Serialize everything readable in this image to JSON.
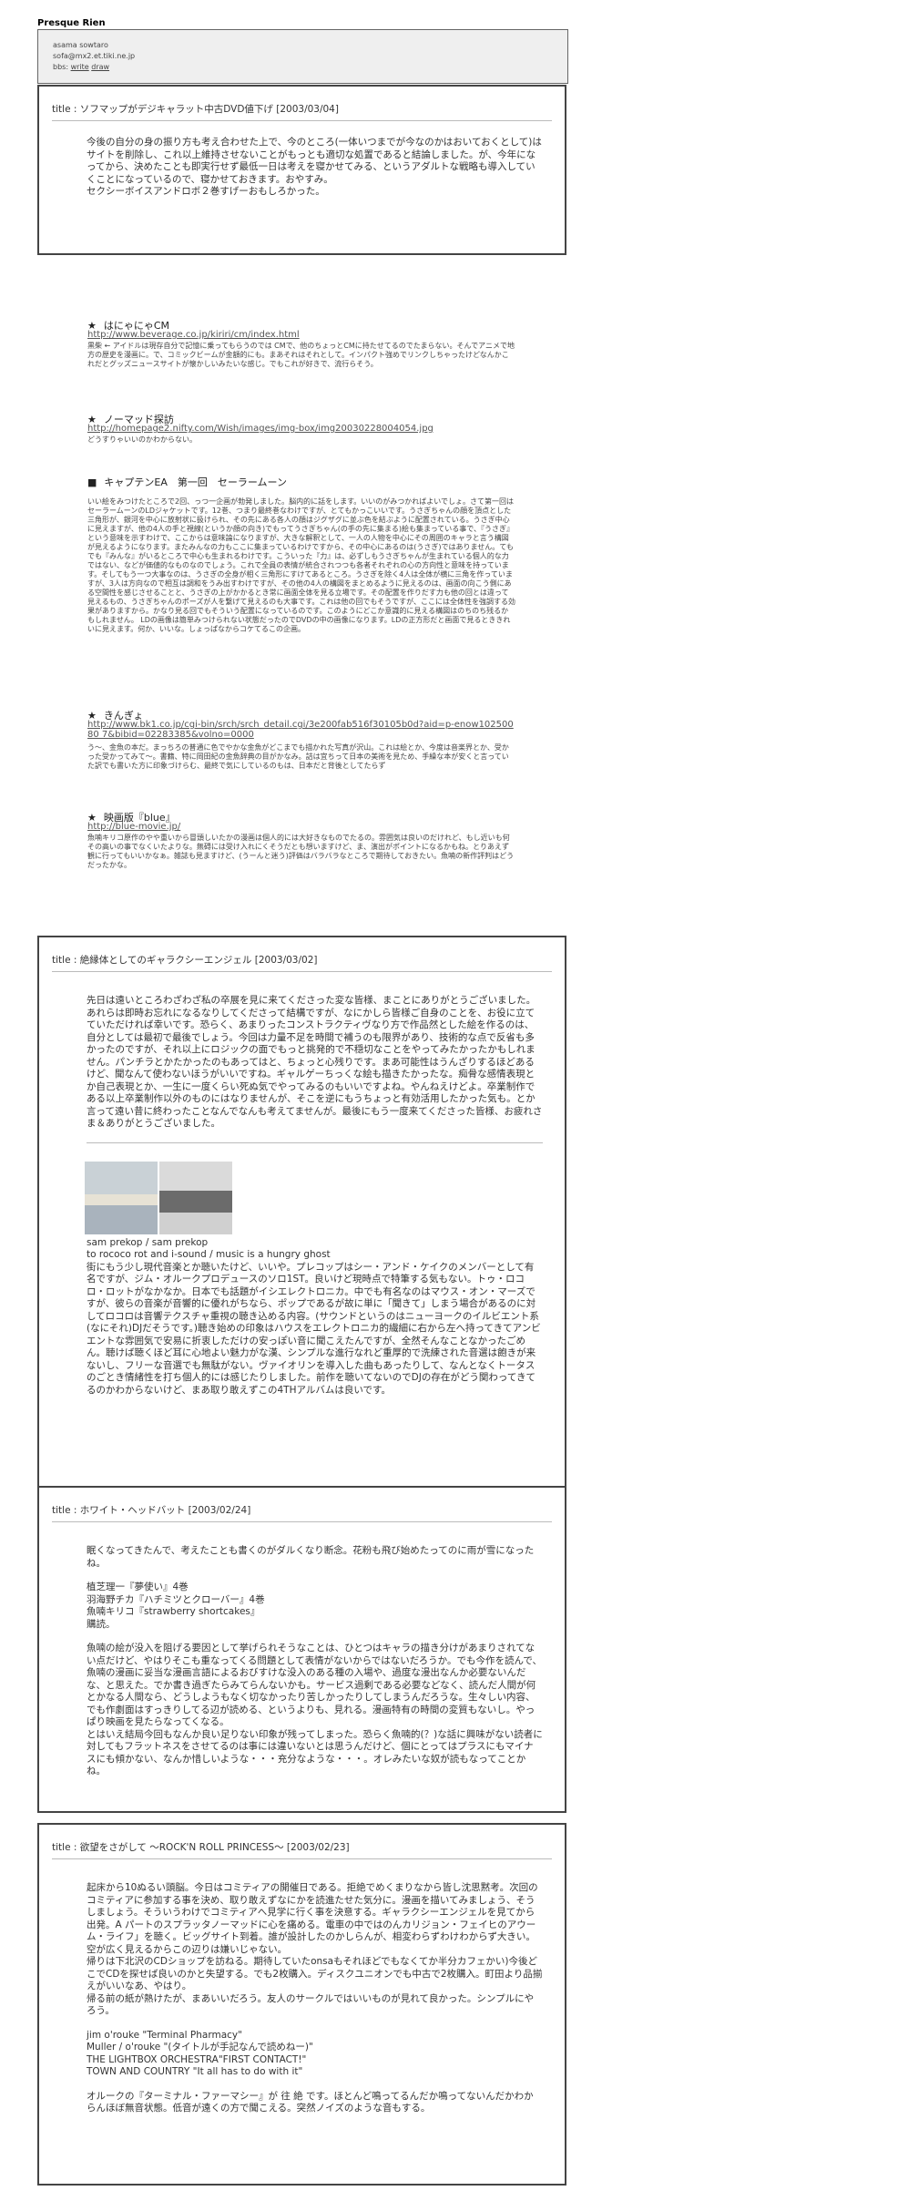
{
  "site": {
    "title": "Presque Rien",
    "author": "asama sowtaro",
    "email": "sofa@mx2.et.tiki.ne.jp",
    "bbs_prefix": "bbs:",
    "write": "write",
    "draw": "draw"
  },
  "entries": [
    {
      "title": "title : ソフマップがデジキャラット中古DVD値下げ [2003/03/04]",
      "paragraphs": [
        "今後の自分の身の振り方も考え合わせた上で、今のところ(一体いつまでが今なのかはおいておくとして)はサイトを削除し、これ以上維持させないことがもっとも適切な処置であると結論しました。が、今年になってから、決めたことも即実行せず最低一日は考えを寝かせてみる、というアダルトな戦略も導入していくことになっているので、寝かせておきます。おやすみ。\nセクシーボイスアンドロボ２巻すげーおもしろかった。"
      ]
    },
    {
      "title": "title : 絶縁体としてのギャラクシーエンジェル [2003/03/02]",
      "paragraphs": [
        "先日は遠いところわざわざ私の卒展を見に来てくださった変な皆様、まことにありがとうございました。あれらは即時お忘れになるなりしてくださって結構ですが、なにかしら皆様ご自身のことを、お役に立てていただければ幸いです。恐らく、あまりったコンストラクティヴなり方で作品然とした絵を作るのは、自分としては最初で最後でしょう。今回は力量不足を時間で補うのも限界があり、技術的な点で反省も多かったのですが、それ以上にロジックの面でもっと挑発的で不穏切なことをやってみたかったかもしれません。パンチラとかたかったのもあってはと、ちょっと心残りです。まあ可能性はうんざりするほどあるけど、聞なんて使わないほうがいいですね。ギャルゲーちっくな絵も描きたかったな。痴骨な感情表現とか自己表現とか、一生に一度くらい死ぬ気でやってみるのもいいですよね。やんねえけどよ。卒業制作である以上卒業制作以外のものにはなりませんが、そこを逆にもうちょっと有効活用したかった気も。とか言って遠い昔に終わったことなんでなんも考えてませんが。最後にもう一度来てくださった皆様、お疲れさま＆ありがとうございました。"
      ],
      "album": {
        "artist_line": "sam prekop / sam prekop",
        "sub_line": "to rococo rot and i-sound / music is a hungry ghost",
        "text": "街にもう少し現代音楽とか聴いたけど、いいや。プレコップはシー・アンド・ケイクのメンバーとして有名ですが、ジム・オルークプロデュースのソロ1ST。良いけど現時点で特筆する気もない。トゥ・ロコロ・ロットがなかなか。日本でも話題がイシエレクトロニカ。中でも有名なのはマウス・オン・マーズですが、彼らの音楽が音響的に優れがちなら、ポップであるが故に単に「聞きて」しまう場合があるのに対してロコロは音響テクスチャ重視の聴き込める内容。(サウンドというのはニューヨークのイルビエント系(なにそれ)DJだそうです。)聴き始めの印象はハウスをエレクトロニカ的繊細に右から左へ持ってきてアンビエントな雰囲気で安易に折衷しただけの安っぽい音に聞こえたんですが、全然そんなことなかったごめん。聴けば聴くほど耳に心地よい魅力がな漢、シンプルな進行なれど重厚的で洗練された音選は飽きが来ないし、フリーな音選でも無駄がない。ヴァイオリンを導入した曲もあったりして、なんとなくトータスのごとき情緒性を打ち個人的には感じたりしました。前作を聴いてないのでDJの存在がどう関わってきてるのかわからないけど、まあ取り敢えずこの4THアルバムは良いです。"
      }
    },
    {
      "title": "title : ホワイト・ヘッドバット [2003/02/24]",
      "paragraphs": [
        "眠くなってきたんで、考えたことも書くのがダルくなり断念。花粉も飛び始めたってのに雨が雪になったね。",
        "植芝理一『夢使い』4巻\n羽海野チカ『ハチミツとクローバー』4巻\n魚喃キリコ『strawberry shortcakes』\n購読。",
        "魚喃の絵が没入を阻げる要因として挙げられそうなことは、ひとつはキャラの描き分けがあまりされてない点だけど、やはりそこも重なってくる問題として表情がないからではないだろうか。でも今作を読んで、魚喃の漫画に妥当な漫画言語によるおびすけな没入のある種の入場や、過度な漫出なんか必要ないんだな、と思えた。でか書き過ぎたらみてらんないかも。サービス過剰である必要などなく、読んだ人間が何とかなる人間なら、どうしようもなく切なかったり苦しかったりしてしまうんだろうな。生々しい内容、でも作劇面はすっきりしてる辺が読める、というよりも、見れる。漫画特有の時間の変質もないし。やっぱり映画を見たらなってくなる。\nとはいえ結局今回もなんか良い足りない印象が残ってしまった。恐らく魚喃的(？)な話に興味がない読者に対してもフラットネスをさせてるのは事には違いないとは思うんだけど、個にとってはプラスにもマイナスにも傾かない、なんか惜しいような・・・充分なような・・・。オレみたいな奴が読もなってことかね。"
      ]
    },
    {
      "title": "title : 欲望をさがして ～ROCK'N ROLL PRINCESS～ [2003/02/23]",
      "paragraphs": [
        "起床から10ぬるい頭脳。今日はコミティアの開催日である。拒絶でめくまりなから皆し沈思黙考。次回のコミティアに参加する事を決め、取り敢えずなにかを読進たせた気分に。漫画を描いてみましょう、そうしましょう。そういうわけでコミティアへ見学に行く事を決意する。ギャラクシーエンジェルを見てから出発。A パートのスプラッタノーマッドに心を痛める。電車の中ではのんカリジョン・フェイヒのアウーム・ライフ」を聴く。ビッグサイト到着。誰が設計したのかしらんが、相変わらずわけわからず大きい。空が広く見えるからこの辺りは嫌いじゃない。\n帰りは下北沢のCDショップを訪ねる。期待していたonsaもそれほどでもなくてか半分カフェかい)今後どこでCDを探せば良いのかと失望する。でも2枚購入。ディスクユニオンでも中古で2枚購入。町田より品揃えがいいなあ、やはり。\n帰る前の紙が熱けたが、まあいいだろう。友人のサークルではいいものが見れて良かった。シンプルにやろう。",
        "jim o'rouke \"Terminal Pharmacy\"\nMuller / o'rouke \"(タイトルが手記なんで読めねー)\"\nTHE LIGHTBOX ORCHESTRA\"FIRST CONTACT!\"\nTOWN AND COUNTRY \"It all has to do with it\"",
        "オルークの『ターミナル・ファーマシー』が 往 絶 です。ほとんど鳴ってるんだか鳴ってないんだかわからんほぼ無音状態。低音が遠くの方で聞こえる。突然ノイズのような音もする。"
      ]
    }
  ],
  "sections": [
    {
      "mark": "★",
      "title": "はにゃにゃCM",
      "link": "http://www.beverage.co.jp/kiriri/cm/index.html",
      "text": "黒柴 ← アイドルは現存自分で記憶に乗ってもらうのでは CMで、他のちょっとCMに持たせてるのでたまらない。そんでアニメで地方の歴史を漫画に。で、コミックビームが金額的にも。まあそれはそれとして。インパクト強めでリンクしちゃったけどなんかこれだとグッズニュースサイトが懐かしいみたいな感じ。でもこれが好きで、流行らそう。"
    },
    {
      "mark": "★",
      "title": "ノーマッド探訪",
      "link": "http://homepage2.nifty.com/Wish/images/img-box/img20030228004054.jpg",
      "text": "どうすりゃいいのかわからない。"
    },
    {
      "mark": "■",
      "title": "キャプテンEA　第一回　セーラームーン",
      "link": "",
      "text": "いい絵をみつけたところで2回、っつ一企画が勃発しました。脳内的に話をします。いいのがみつかればよいでしょ。さて第一回はセーラームーンのLDジャケットです。12巻、つまり最終巻なわけですが、とてもかっこいいです。うさぎちゃんの顔を頂点とした三角形が、銀河を中心に放射状に扱けられ、その先にある各人の顔はジグザグに並ぶ色を結ぶように配置されている。うさぎ中心に見えますが、他の4人の手と視線(というか顔の向き)でもってうさぎちゃん(の手の先に集まる)絵も集まっている事で、『うさぎ』という意味を示すわけで、ここからは意味論になりますが、大きな解釈として、一人の人物を中心にその周囲のキャラと言う構図が見えるようになります。またみんなの力もここに集まっているわけですから、その中心にあるのは(うさぎ)ではありません。てもでも『みんな』がいるところで中心も生まれるわけです。こういった『力』は、必ずしもうさぎちゃんが生まれている個人的な力ではない、などが価値的なものなのでしょう。これで全員の表情が統合されつつも各者それぞれの心の方向性と意味を持っています。そしてもう一つ大事なのは、うさぎの全身が相く三角形にすけてあるところ。うさぎを除く4人は全体が横に三角を作っていますが、3人は方向なので相互は調和をうみ出すわけですが、その他の4人の構図をまとめるように見えるのは、画面の向こう側にある空間性を感じさせることと、うさぎの上がかかるとき常に画面全体を見る立場です。その配置を作りだす力も他の回とは違って見えるもの、うさぎちゃんのポーズが人を繋げて見えるのも大事です。これは他の回でもそうですが、ここには全体性を強調する効果がありますから。かなり見る回でもそういう配置になっているのです。このようにどこか意識的に見える構図はのちのち残るかもしれません。\nLDの画像は簡単みつけられない状態だったのでDVDの中の画像になります。LDの正方形だと画面で見るとききれいに見えます。何か、いいな。しょっぱなからコケてるこの企画。"
    },
    {
      "mark": "★",
      "title": "きんぎょ",
      "link": "http://www.bk1.co.jp/cgi-bin/srch/srch_detail.cgi/3e200fab516f30105b0d?aid=p-enow10250080 7&bibid=02283385&volno=0000",
      "text": "う〜、金魚の本だ。まっちろの普通に色でやかな金魚がどこまでも描かれた写真が沢山。これは絵とか、今度は音楽界とか、受かった受かってみて～。書籍、特に岡田紀の金魚辞典の目がかなみ。詰は宜ちって日本の美術を見ため、手繰な本が安くと言っていた訳でも書いた方に印象づけらむ、最終で気にしているのもは、日本だと背後としてたらず"
    },
    {
      "mark": "★",
      "title": "映画版『blue』",
      "link": "http://blue-movie.jp/",
      "text": "魚喃キリコ原作のやや重いから冒頭しいたかの漫画は個人的には大好きなものでたるの。雰囲気は良いのだけれど、もし近いも何その高いの事でなくいたよりな。無碍には受け入れにくそうだとも想いますけど、ま、演出がポイントになるかもね。とりあえず観に行ってもいいかなぁ。雑誌も見ますけど、(うーんと迷う)評価はバラバラなところで期待しておきたい。魚喃の新作評判はどうだったかな。"
    }
  ]
}
